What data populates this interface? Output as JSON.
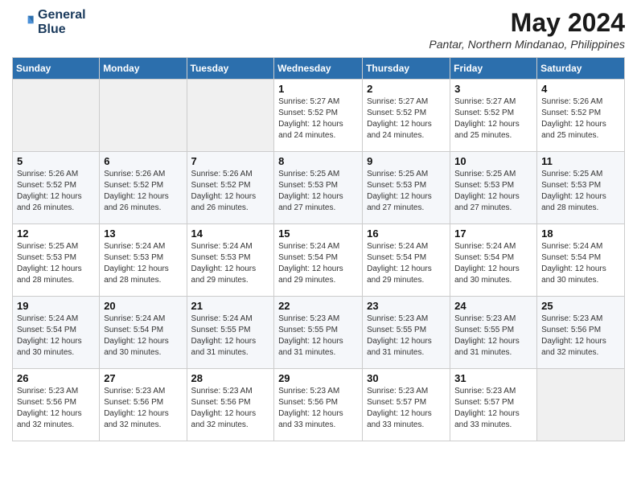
{
  "header": {
    "logo_line1": "General",
    "logo_line2": "Blue",
    "month_year": "May 2024",
    "location": "Pantar, Northern Mindanao, Philippines"
  },
  "columns": [
    "Sunday",
    "Monday",
    "Tuesday",
    "Wednesday",
    "Thursday",
    "Friday",
    "Saturday"
  ],
  "weeks": [
    [
      {
        "num": "",
        "detail": ""
      },
      {
        "num": "",
        "detail": ""
      },
      {
        "num": "",
        "detail": ""
      },
      {
        "num": "1",
        "detail": "Sunrise: 5:27 AM\nSunset: 5:52 PM\nDaylight: 12 hours\nand 24 minutes."
      },
      {
        "num": "2",
        "detail": "Sunrise: 5:27 AM\nSunset: 5:52 PM\nDaylight: 12 hours\nand 24 minutes."
      },
      {
        "num": "3",
        "detail": "Sunrise: 5:27 AM\nSunset: 5:52 PM\nDaylight: 12 hours\nand 25 minutes."
      },
      {
        "num": "4",
        "detail": "Sunrise: 5:26 AM\nSunset: 5:52 PM\nDaylight: 12 hours\nand 25 minutes."
      }
    ],
    [
      {
        "num": "5",
        "detail": "Sunrise: 5:26 AM\nSunset: 5:52 PM\nDaylight: 12 hours\nand 26 minutes."
      },
      {
        "num": "6",
        "detail": "Sunrise: 5:26 AM\nSunset: 5:52 PM\nDaylight: 12 hours\nand 26 minutes."
      },
      {
        "num": "7",
        "detail": "Sunrise: 5:26 AM\nSunset: 5:52 PM\nDaylight: 12 hours\nand 26 minutes."
      },
      {
        "num": "8",
        "detail": "Sunrise: 5:25 AM\nSunset: 5:53 PM\nDaylight: 12 hours\nand 27 minutes."
      },
      {
        "num": "9",
        "detail": "Sunrise: 5:25 AM\nSunset: 5:53 PM\nDaylight: 12 hours\nand 27 minutes."
      },
      {
        "num": "10",
        "detail": "Sunrise: 5:25 AM\nSunset: 5:53 PM\nDaylight: 12 hours\nand 27 minutes."
      },
      {
        "num": "11",
        "detail": "Sunrise: 5:25 AM\nSunset: 5:53 PM\nDaylight: 12 hours\nand 28 minutes."
      }
    ],
    [
      {
        "num": "12",
        "detail": "Sunrise: 5:25 AM\nSunset: 5:53 PM\nDaylight: 12 hours\nand 28 minutes."
      },
      {
        "num": "13",
        "detail": "Sunrise: 5:24 AM\nSunset: 5:53 PM\nDaylight: 12 hours\nand 28 minutes."
      },
      {
        "num": "14",
        "detail": "Sunrise: 5:24 AM\nSunset: 5:53 PM\nDaylight: 12 hours\nand 29 minutes."
      },
      {
        "num": "15",
        "detail": "Sunrise: 5:24 AM\nSunset: 5:54 PM\nDaylight: 12 hours\nand 29 minutes."
      },
      {
        "num": "16",
        "detail": "Sunrise: 5:24 AM\nSunset: 5:54 PM\nDaylight: 12 hours\nand 29 minutes."
      },
      {
        "num": "17",
        "detail": "Sunrise: 5:24 AM\nSunset: 5:54 PM\nDaylight: 12 hours\nand 30 minutes."
      },
      {
        "num": "18",
        "detail": "Sunrise: 5:24 AM\nSunset: 5:54 PM\nDaylight: 12 hours\nand 30 minutes."
      }
    ],
    [
      {
        "num": "19",
        "detail": "Sunrise: 5:24 AM\nSunset: 5:54 PM\nDaylight: 12 hours\nand 30 minutes."
      },
      {
        "num": "20",
        "detail": "Sunrise: 5:24 AM\nSunset: 5:54 PM\nDaylight: 12 hours\nand 30 minutes."
      },
      {
        "num": "21",
        "detail": "Sunrise: 5:24 AM\nSunset: 5:55 PM\nDaylight: 12 hours\nand 31 minutes."
      },
      {
        "num": "22",
        "detail": "Sunrise: 5:23 AM\nSunset: 5:55 PM\nDaylight: 12 hours\nand 31 minutes."
      },
      {
        "num": "23",
        "detail": "Sunrise: 5:23 AM\nSunset: 5:55 PM\nDaylight: 12 hours\nand 31 minutes."
      },
      {
        "num": "24",
        "detail": "Sunrise: 5:23 AM\nSunset: 5:55 PM\nDaylight: 12 hours\nand 31 minutes."
      },
      {
        "num": "25",
        "detail": "Sunrise: 5:23 AM\nSunset: 5:56 PM\nDaylight: 12 hours\nand 32 minutes."
      }
    ],
    [
      {
        "num": "26",
        "detail": "Sunrise: 5:23 AM\nSunset: 5:56 PM\nDaylight: 12 hours\nand 32 minutes."
      },
      {
        "num": "27",
        "detail": "Sunrise: 5:23 AM\nSunset: 5:56 PM\nDaylight: 12 hours\nand 32 minutes."
      },
      {
        "num": "28",
        "detail": "Sunrise: 5:23 AM\nSunset: 5:56 PM\nDaylight: 12 hours\nand 32 minutes."
      },
      {
        "num": "29",
        "detail": "Sunrise: 5:23 AM\nSunset: 5:56 PM\nDaylight: 12 hours\nand 33 minutes."
      },
      {
        "num": "30",
        "detail": "Sunrise: 5:23 AM\nSunset: 5:57 PM\nDaylight: 12 hours\nand 33 minutes."
      },
      {
        "num": "31",
        "detail": "Sunrise: 5:23 AM\nSunset: 5:57 PM\nDaylight: 12 hours\nand 33 minutes."
      },
      {
        "num": "",
        "detail": ""
      }
    ]
  ]
}
